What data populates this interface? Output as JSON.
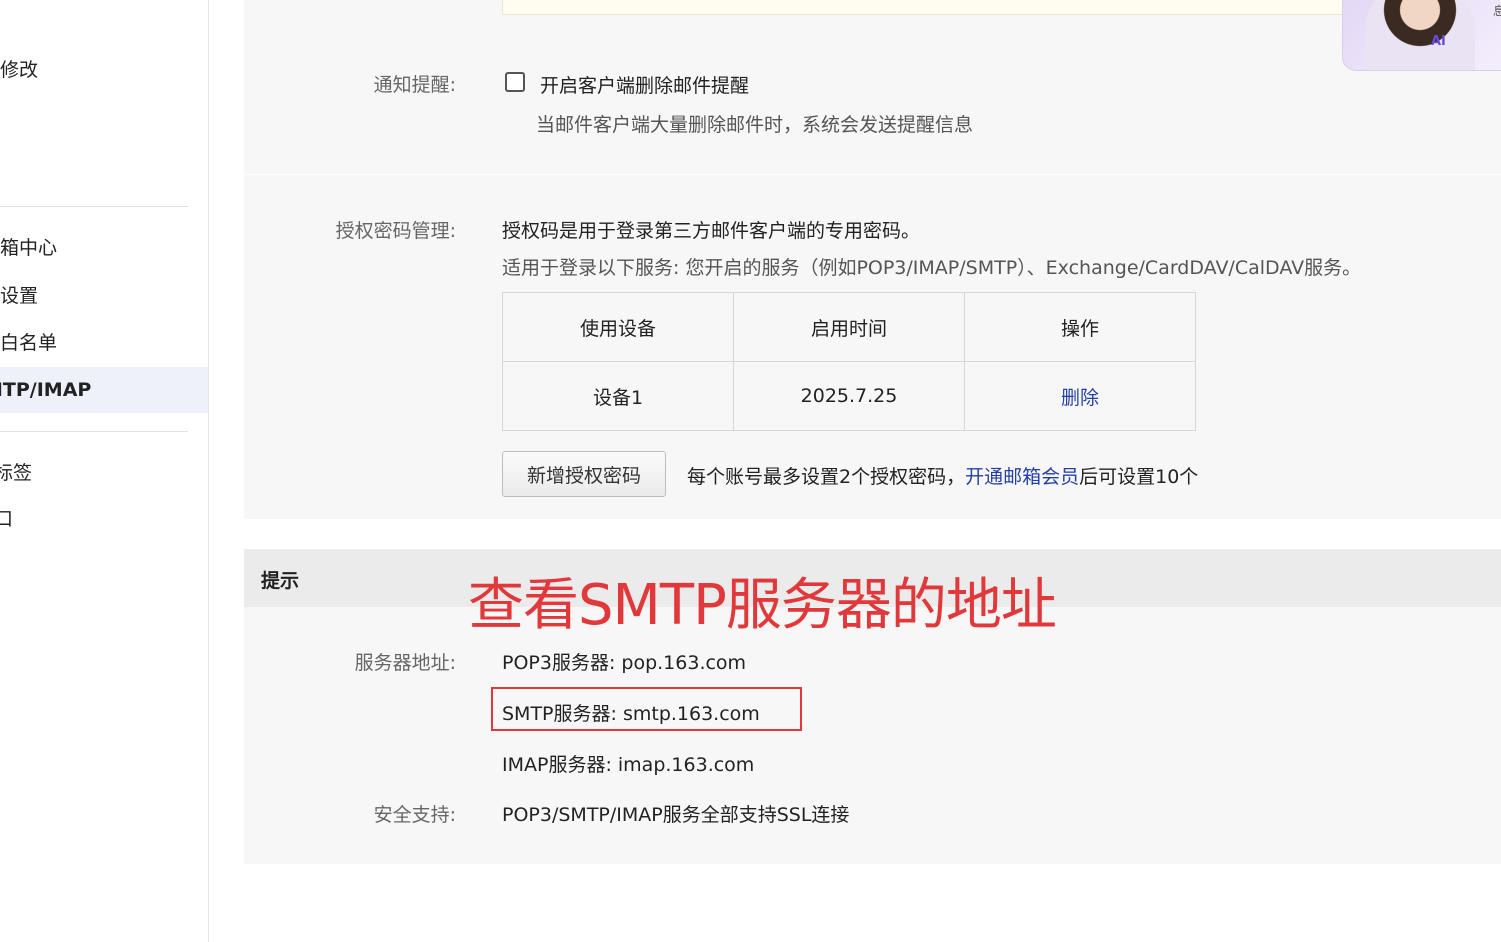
{
  "sidebar": {
    "items": [
      {
        "label": "修改"
      },
      {
        "label": "箱中心"
      },
      {
        "label": "设置"
      },
      {
        "label": "黑白名单"
      },
      {
        "label": "MTP/IMAP",
        "active": true
      },
      {
        "label": "标签"
      },
      {
        "label": "口"
      }
    ]
  },
  "notify": {
    "label": "通知提醒:",
    "checkbox_label": "开启客户端删除邮件提醒",
    "checked": false,
    "description": "当邮件客户端大量删除邮件时，系统会发送提醒信息"
  },
  "auth": {
    "label": "授权密码管理:",
    "intro": "授权码是用于登录第三方邮件客户端的专用密码。",
    "services": "适用于登录以下服务: 您开启的服务（例如POP3/IMAP/SMTP）、Exchange/CardDAV/CalDAV服务。",
    "table": {
      "headers": [
        "使用设备",
        "启用时间",
        "操作"
      ],
      "rows": [
        {
          "device": "设备1",
          "time": "2025.7.25",
          "action": "删除"
        }
      ]
    },
    "add_button": "新增授权密码",
    "limit_prefix": "每个账号最多设置2个授权密码，",
    "limit_link": "开通邮箱会员",
    "limit_suffix": "后可设置10个"
  },
  "tips": {
    "title": "提示",
    "server_label": "服务器地址:",
    "pop3": "POP3服务器: pop.163.com",
    "smtp": "SMTP服务器: smtp.163.com",
    "imap": "IMAP服务器: imap.163.com",
    "security_label": "安全支持:",
    "security": "POP3/SMTP/IMAP服务全部支持SSL连接"
  },
  "annotation": {
    "text": "查看SMTP服务器的地址",
    "color": "#e0383b"
  },
  "ai_widget": {
    "badge": "AI",
    "edge_text": "息"
  },
  "colors": {
    "link": "#2440a8",
    "panel_bg": "#f7f7f7",
    "active_nav_bg": "#eef1fa"
  }
}
